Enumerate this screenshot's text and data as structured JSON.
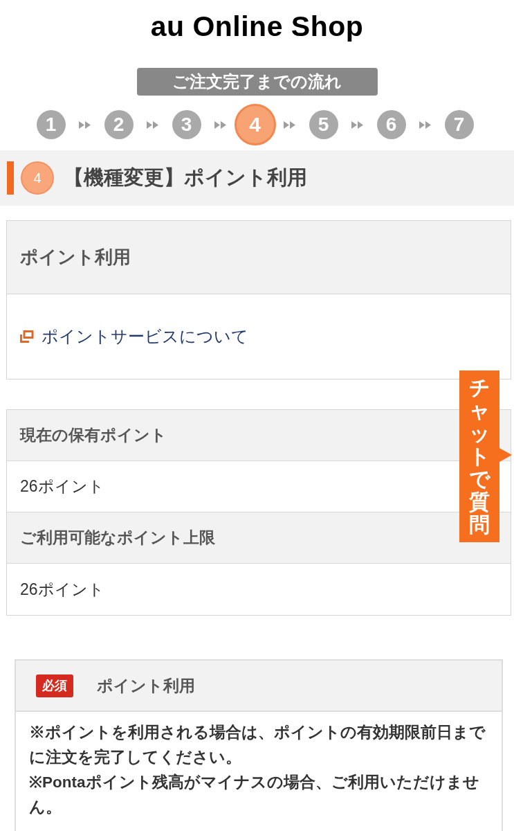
{
  "header": {
    "logo": "au Online Shop"
  },
  "flow": {
    "title": "ご注文完了までの流れ",
    "steps": [
      {
        "label": "1",
        "selected": false
      },
      {
        "label": "2",
        "selected": false
      },
      {
        "label": "3",
        "selected": false
      },
      {
        "label": "4",
        "selected": true
      },
      {
        "label": "5",
        "selected": false
      },
      {
        "label": "6",
        "selected": false
      },
      {
        "label": "7",
        "selected": false
      }
    ]
  },
  "page_heading": {
    "step": "4",
    "title": "【機種変更】ポイント利用"
  },
  "point_card": {
    "title": "ポイント利用",
    "link": "ポイントサービスについて"
  },
  "balance_table": {
    "rows": [
      {
        "kind": "header",
        "text": "現在の保有ポイント"
      },
      {
        "kind": "value",
        "text": "26ポイント"
      },
      {
        "kind": "header",
        "text": "ご利用可能なポイント上限"
      },
      {
        "kind": "value",
        "text": "26ポイント"
      }
    ]
  },
  "chat_tab": {
    "label": "チャットで質問"
  },
  "point_use": {
    "badge": "必須",
    "title": "ポイント利用",
    "notes": [
      "※ポイントを利用される場合は、ポイントの有効期限前日までに注文を完了してください。",
      "※Pontaポイント残高がマイナスの場合、ご利用いただけません。"
    ]
  }
}
